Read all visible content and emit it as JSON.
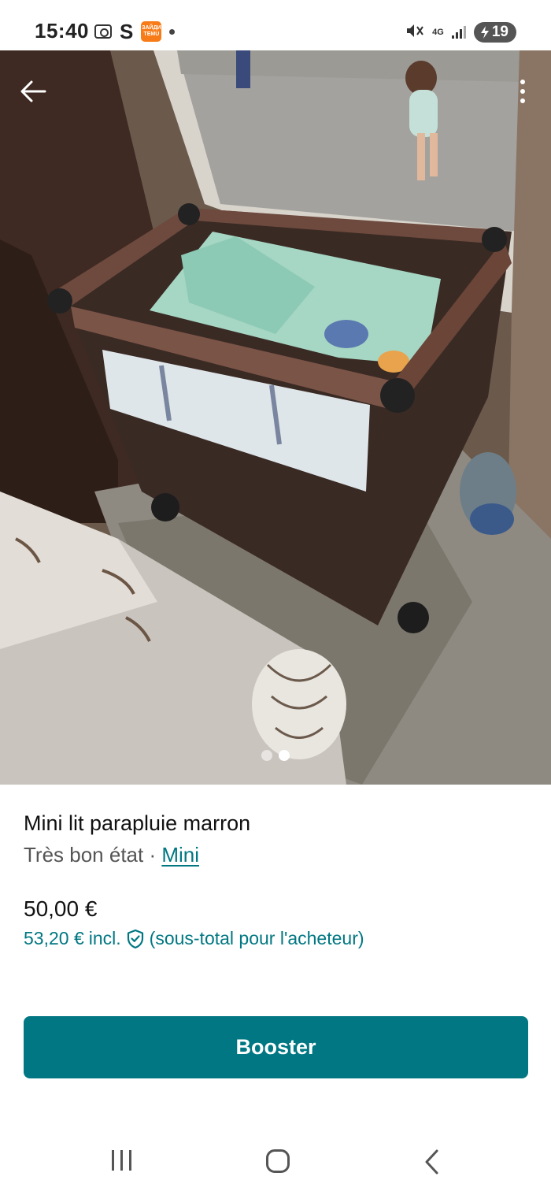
{
  "status_bar": {
    "time": "15:40",
    "left_icons": [
      "screen-recorder-icon",
      "s-app-icon",
      "temu-app-icon",
      "notification-dot-icon"
    ],
    "temu_text": "ЗАЙДИ TEMU",
    "s_letter": "S",
    "network": "4G",
    "battery": "19",
    "right_icons": [
      "mute-icon",
      "4g-icon",
      "signal-icon",
      "battery-icon"
    ]
  },
  "photo": {
    "carousel": {
      "count": 2,
      "active_index": 1
    }
  },
  "listing": {
    "title": "Mini lit parapluie marron",
    "condition": "Très bon état",
    "separator": " · ",
    "brand": "Mini",
    "price": "50,00 €",
    "price_incl": "53,20 €",
    "incl_label": "incl.",
    "buyer_note": "(sous-total pour l'acheteur)"
  },
  "actions": {
    "booster_label": "Booster"
  },
  "colors": {
    "accent": "#007782",
    "title_text": "#111111",
    "meta_text": "#555555"
  }
}
